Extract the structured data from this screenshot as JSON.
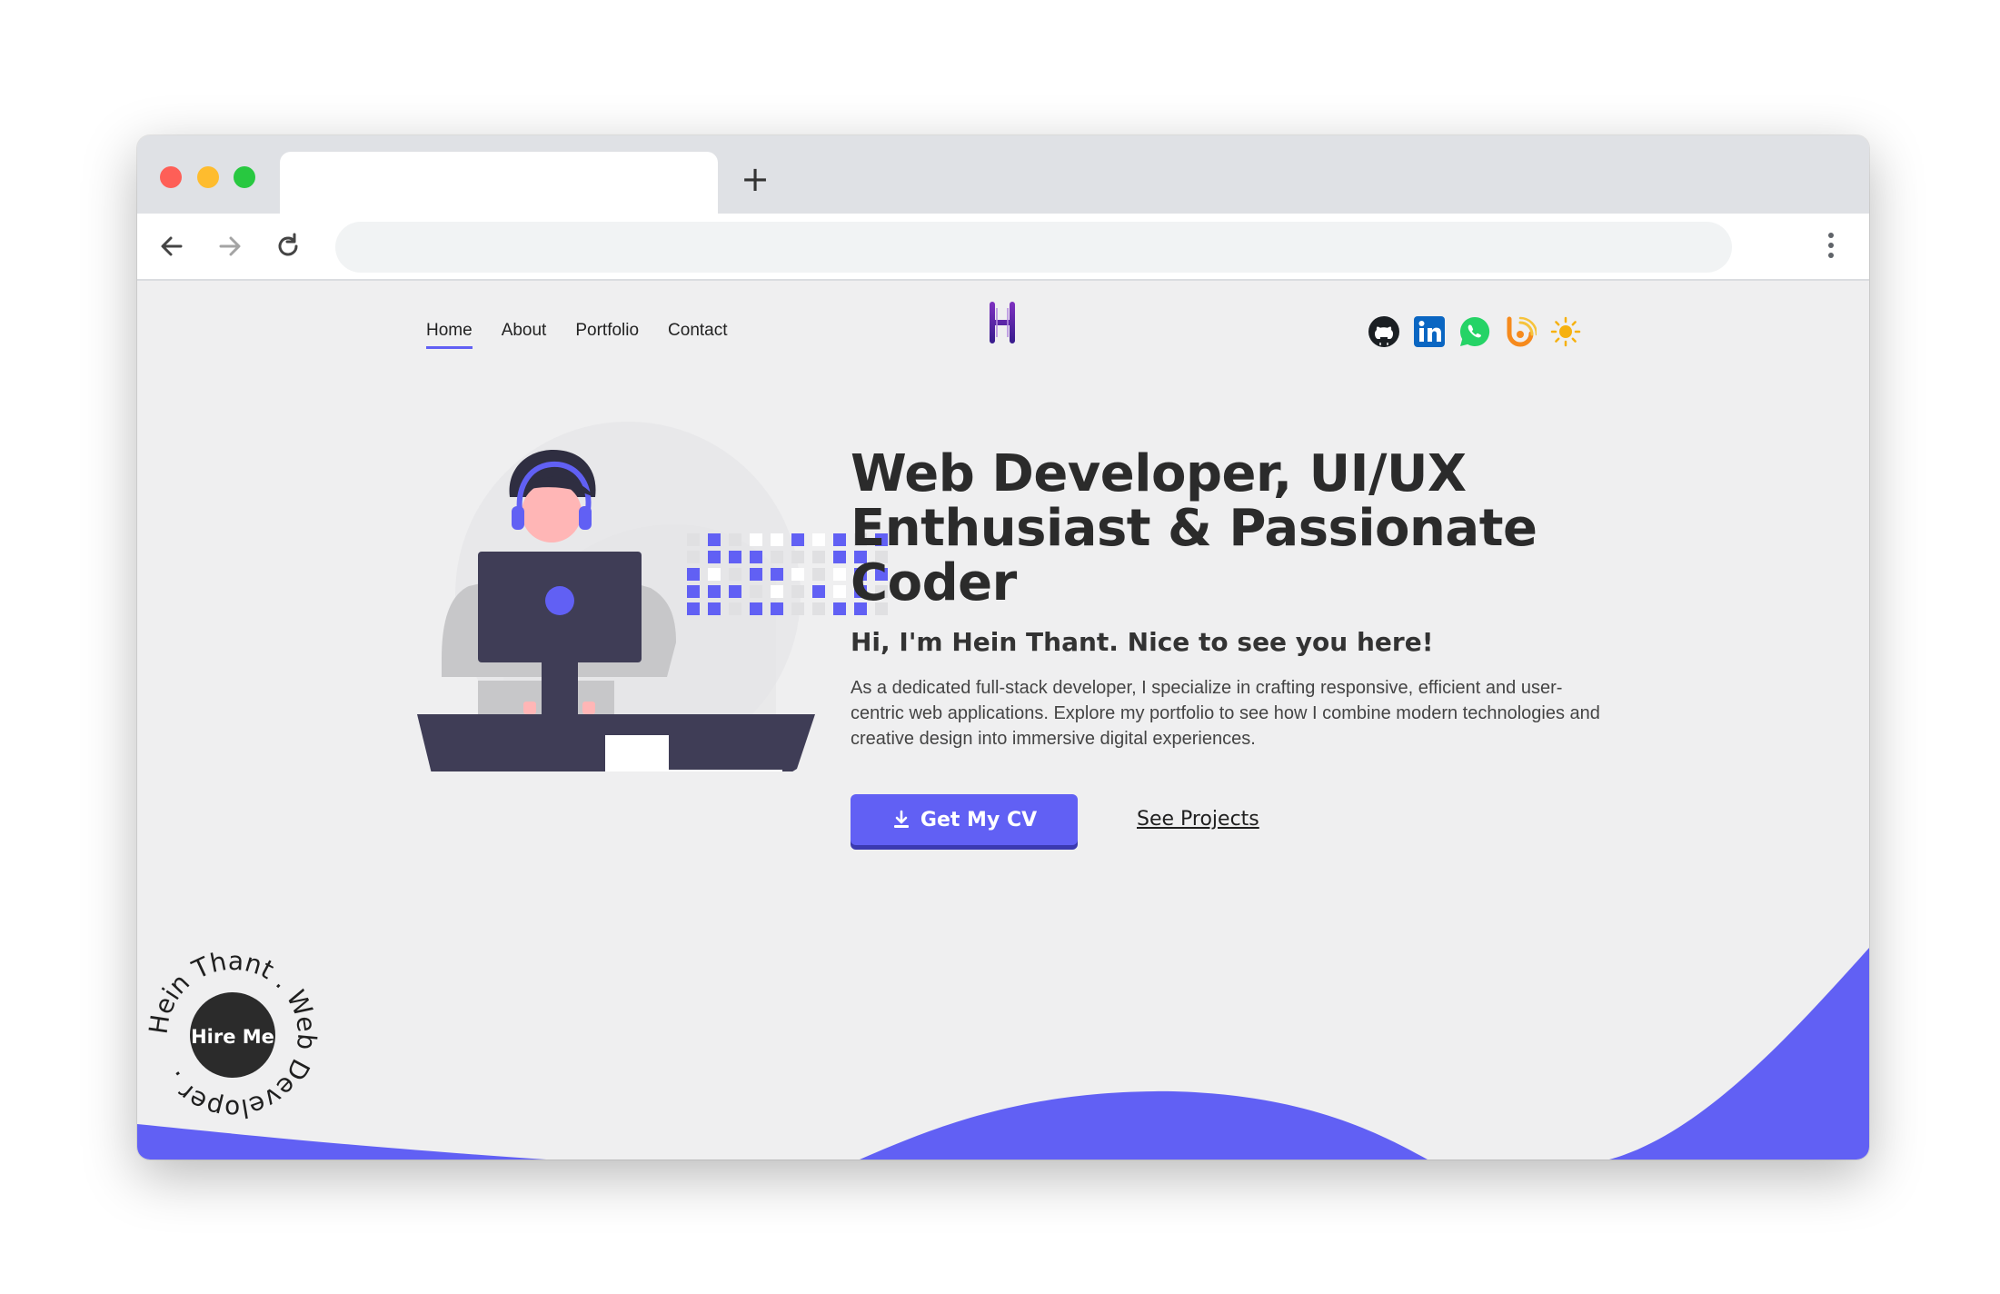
{
  "browser": {
    "tab_title": "",
    "address_value": "",
    "new_tab_label": "+"
  },
  "site": {
    "nav": [
      {
        "label": "Home",
        "active": true
      },
      {
        "label": "About",
        "active": false
      },
      {
        "label": "Portfolio",
        "active": false
      },
      {
        "label": "Contact",
        "active": false
      }
    ],
    "logo_text": "H",
    "socials": [
      "github-icon",
      "linkedin-icon",
      "whatsapp-icon",
      "blogger-icon",
      "sun-icon"
    ]
  },
  "hero": {
    "headline_line1": "Web Developer, UI/UX",
    "headline_line2": "Enthusiast & Passionate",
    "headline_line3": "Coder",
    "subheadline": "Hi, I'm Hein Thant. Nice to see you here!",
    "description": "As a dedicated full-stack developer, I specialize in crafting responsive, efficient and user-centric web applications. Explore my portfolio to see how I combine modern technologies and creative design into immersive digital experiences.",
    "cta_label": "Get My CV",
    "secondary_link": "See Projects"
  },
  "badge": {
    "center_label": "Hire Me",
    "ring_text": "Hein Thant . Web Developer ."
  },
  "colors": {
    "accent": "#6160f4",
    "dark": "#3f3d56",
    "background": "#efeff0",
    "skin": "#ffb6b6"
  }
}
